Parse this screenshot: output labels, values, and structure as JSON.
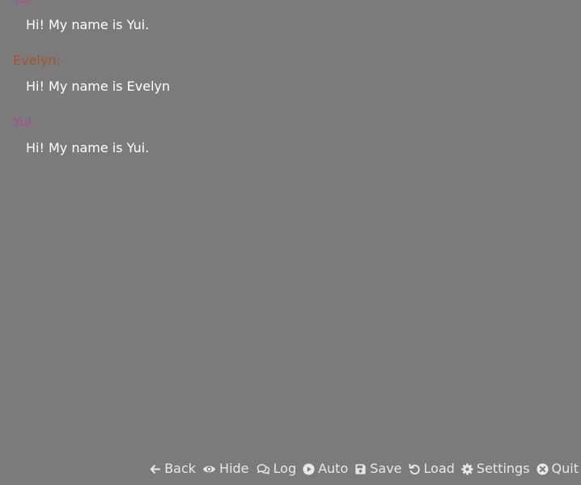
{
  "colors": {
    "background": "#7b7b7b",
    "yui": "#b0479b",
    "evelyn": "#a6542c",
    "text": "#ffffff",
    "menu": "#e8e8e8"
  },
  "history": [
    {
      "speaker": "Yui:",
      "text": "Hi! My name is Yui."
    },
    {
      "speaker": "Evelyn:",
      "text": "Hi! My name is Evelyn"
    },
    {
      "speaker": "Yui:",
      "text": "Hi! My name is Yui."
    }
  ],
  "quick_menu": {
    "back": "Back",
    "hide": "Hide",
    "log": "Log",
    "auto": "Auto",
    "save": "Save",
    "load": "Load",
    "settings": "Settings",
    "quit": "Quit"
  }
}
